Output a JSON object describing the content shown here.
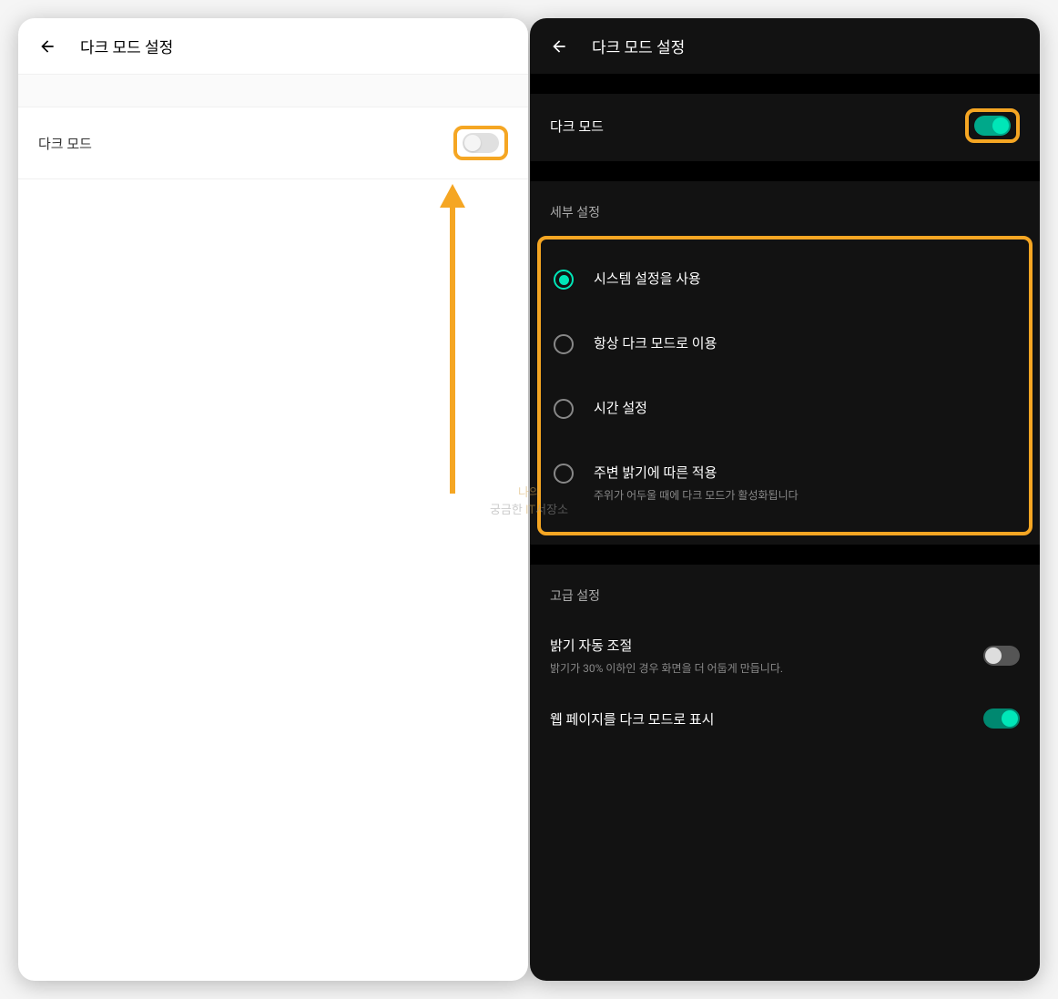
{
  "left": {
    "header": {
      "title": "다크 모드 설정"
    },
    "darkmode_row": {
      "label": "다크 모드"
    }
  },
  "right": {
    "header": {
      "title": "다크 모드 설정"
    },
    "darkmode_row": {
      "label": "다크 모드"
    },
    "detail_section": {
      "title": "세부 설정"
    },
    "radios": [
      {
        "label": "시스템 설정을 사용",
        "sublabel": "",
        "selected": true
      },
      {
        "label": "항상 다크 모드로 이용",
        "sublabel": "",
        "selected": false
      },
      {
        "label": "시간 설정",
        "sublabel": "",
        "selected": false
      },
      {
        "label": "주변 밝기에 따른 적용",
        "sublabel": "주위가 어두울 때에 다크 모드가 활성화됩니다",
        "selected": false
      }
    ],
    "advanced_section": {
      "title": "고급 설정"
    },
    "brightness": {
      "label": "밝기 자동 조절",
      "sublabel": "밝기가 30% 이하인 경우 화면을 더 어둡게 만듭니다."
    },
    "webpage": {
      "label": "웹 페이지를 다크 모드로 표시"
    }
  },
  "watermark": {
    "line1": "나의",
    "line2a": "궁금한 ",
    "line2b": "IT",
    "line2c": "서장소"
  }
}
